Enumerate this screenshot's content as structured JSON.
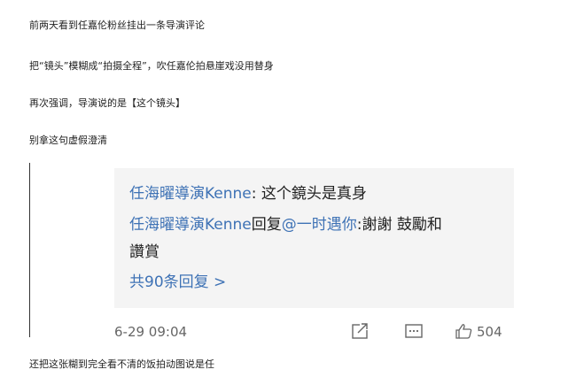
{
  "article": {
    "line1": "前两天看到任嘉伦粉丝挂出一条导演评论",
    "line2": "把“镜头”模糊成“拍摄全程”，吹任嘉伦拍悬崖戏没用替身",
    "line3": "再次强调，导演说的是【这个镜头】",
    "line4": "别拿这句虚假澄清",
    "line5": "还把这张糊到完全看不清的饭拍动图说是任"
  },
  "comment": {
    "author1": "任海曜導演Kenne",
    "text1": ": 这个鏡头是真身",
    "author2": "任海曜導演Kenne",
    "reply_word": "回复",
    "mention": "@一时遇你",
    "text2": ":謝謝 鼓勵和",
    "text2_cont": "讚賞",
    "replies_link": "共90条回复 >",
    "date": "6-29 09:04",
    "likes": "504"
  },
  "icons": {
    "share": "share-icon",
    "comment": "comment-icon",
    "like": "thumbs-up-icon"
  },
  "colors": {
    "link": "#3e72b5",
    "card_bg": "#f4f4f4",
    "meta": "#666666"
  }
}
